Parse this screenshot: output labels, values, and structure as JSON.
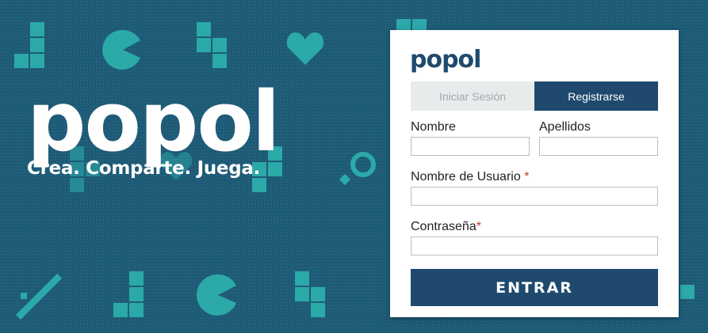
{
  "brand": {
    "hero_logo": "popol",
    "tagline": "Crea. Comparte. Juega.",
    "card_logo": "popol"
  },
  "tabs": [
    {
      "label": "Iniciar Sesión",
      "active": false
    },
    {
      "label": "Registrarse",
      "active": true
    }
  ],
  "form": {
    "first_name_label": "Nombre",
    "last_name_label": "Apellidos",
    "username_label": "Nombre de Usuario",
    "password_label": "Contraseña",
    "required_mark": "*",
    "first_name_value": "",
    "last_name_value": "",
    "username_value": "",
    "password_value": "",
    "submit_label": "ENTRAR"
  },
  "colors": {
    "background": "#1c5a76",
    "accent": "#1f4a6e",
    "pixel_icons": "#2fb8b3",
    "required": "#c0392b"
  },
  "decor_icons": [
    "tetromino-icon",
    "pacman-icon",
    "heart-icon",
    "magnifier-icon",
    "sword-icon"
  ]
}
